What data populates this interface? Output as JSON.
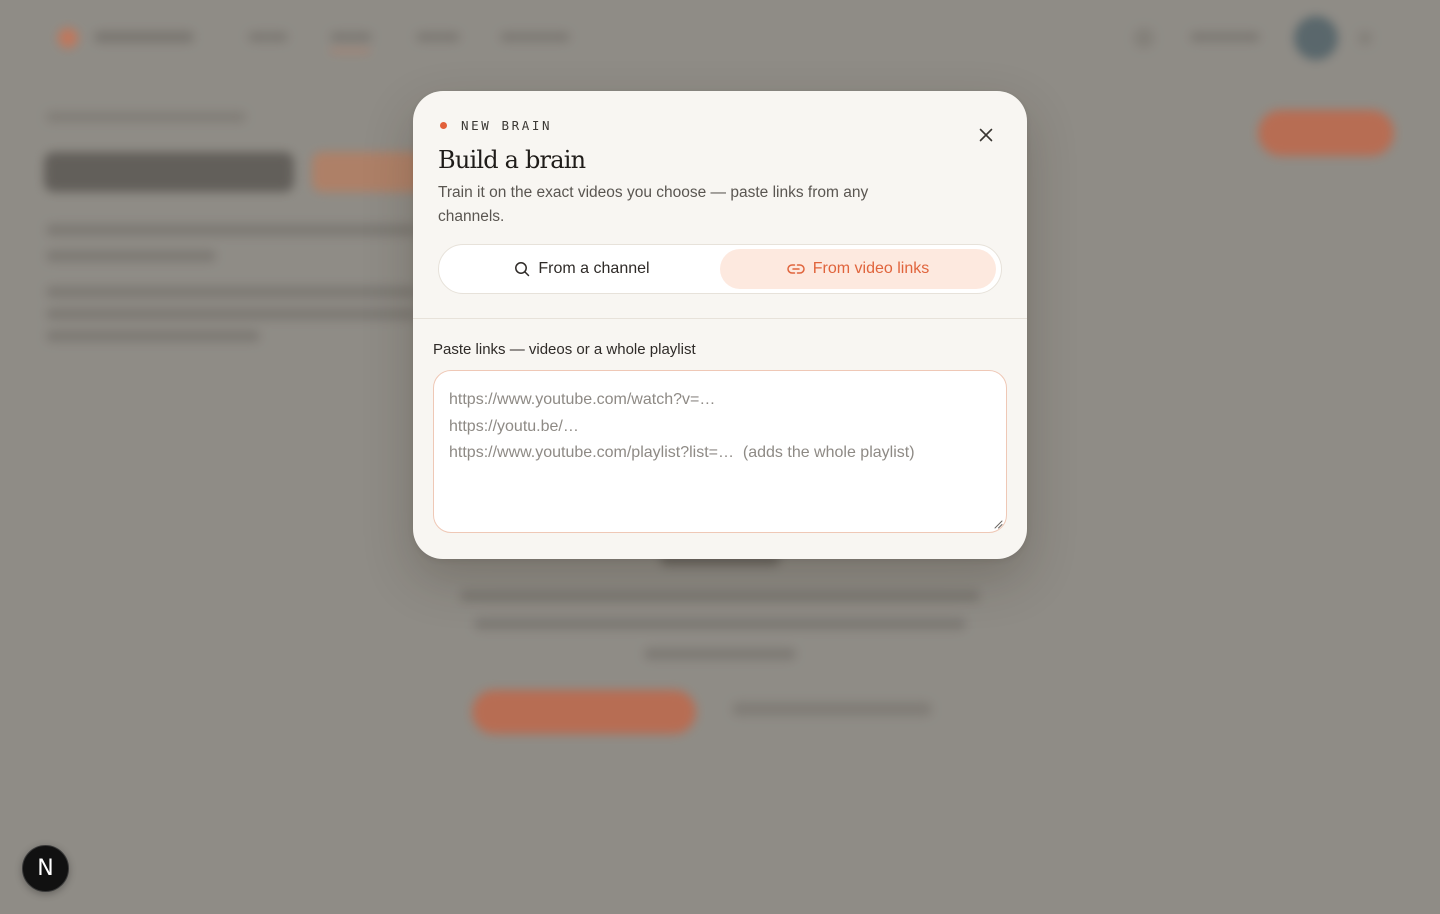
{
  "modal": {
    "eyebrow": "NEW BRAIN",
    "title": "Build a brain",
    "description": "Train it on the exact videos you choose — paste links from any channels.",
    "tabs": [
      {
        "label": "From a channel",
        "icon": "search-icon",
        "active": false
      },
      {
        "label": "From video links",
        "icon": "link-icon",
        "active": true
      }
    ],
    "field_label": "Paste links — videos or a whole playlist",
    "textarea_placeholder": "https://www.youtube.com/watch?v=…\nhttps://youtu.be/…\nhttps://www.youtube.com/playlist?list=…  (adds the whole playlist)",
    "textarea_value": ""
  },
  "badge": {
    "letter": "N"
  },
  "colors": {
    "accent": "#e2603a",
    "accent_soft": "#fde9df",
    "modal_bg": "#f8f6f2",
    "overlay": "#8f8c86"
  }
}
